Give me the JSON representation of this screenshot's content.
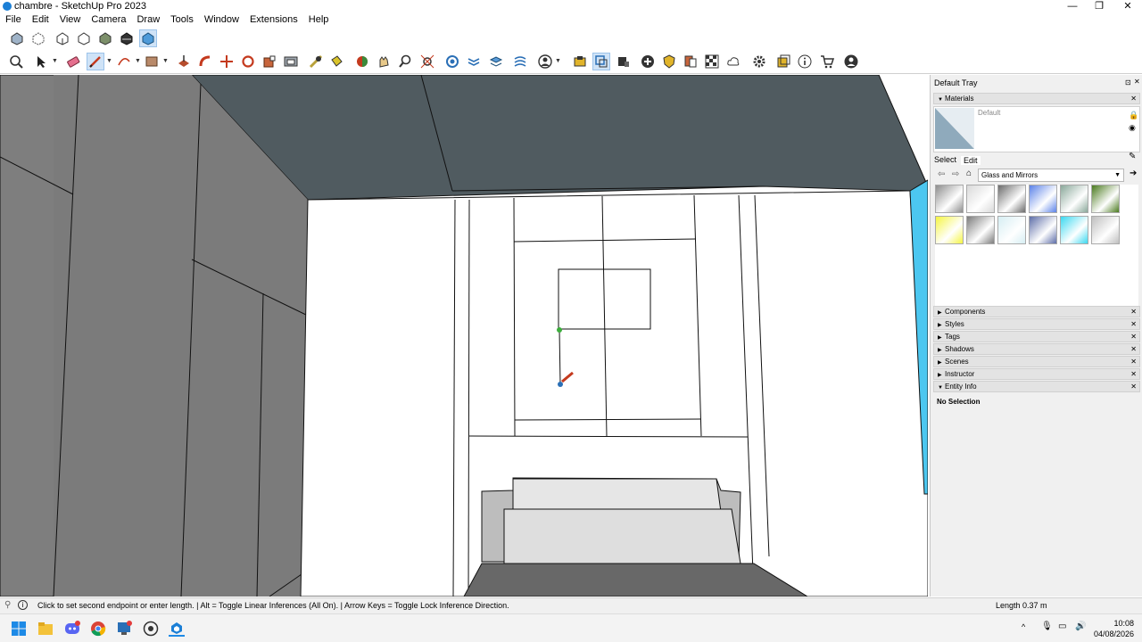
{
  "window": {
    "title": "chambre - SketchUp Pro 2023",
    "minimize": "—",
    "maximize": "❐",
    "close": "✕"
  },
  "menu": [
    "File",
    "Edit",
    "View",
    "Camera",
    "Draw",
    "Tools",
    "Window",
    "Extensions",
    "Help"
  ],
  "tray": {
    "title": "Default Tray",
    "materials": {
      "header": "Materials",
      "current_material": "Default",
      "tabs": [
        "Select",
        "Edit"
      ],
      "library": "Glass and Mirrors",
      "swatch_colors": [
        "#8d8d8d",
        "#d9d9d9",
        "#6b6b6b",
        "#5b82e8",
        "#8aa89a",
        "#4a7a1e",
        "#f5f542",
        "#7c7c7c",
        "#d6eef3",
        "#5d6ea8",
        "#3bd8f0",
        "#bfbfbf"
      ]
    },
    "panels": [
      "Components",
      "Styles",
      "Tags",
      "Shadows",
      "Scenes",
      "Instructor",
      "Entity Info"
    ],
    "entity_info": "No Selection"
  },
  "status": {
    "hint": "Click to set second endpoint or enter length. | Alt = Toggle Linear Inferences (All On). | Arrow Keys = Toggle Lock Inference Direction.",
    "length_label": "Length",
    "length_value": "0.37 m"
  },
  "taskbar": {
    "time": "10:08",
    "date": "04/08/2026"
  }
}
